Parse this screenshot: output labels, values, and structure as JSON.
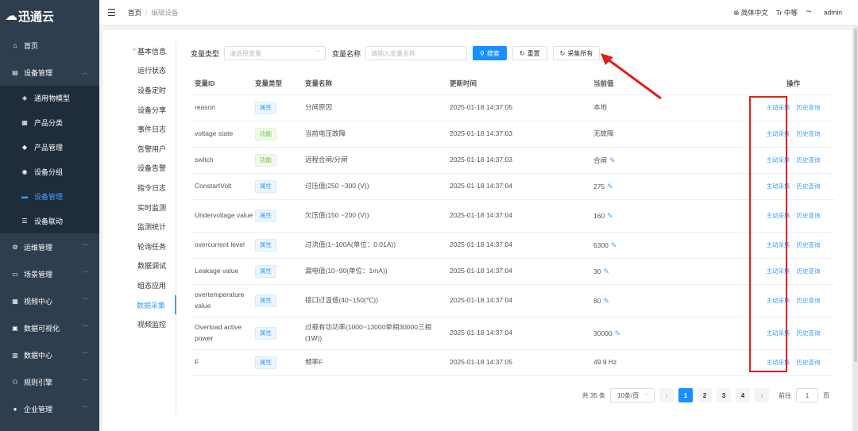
{
  "app": {
    "logo": "迅通云"
  },
  "sidebar": {
    "items": [
      {
        "label": "首页",
        "icon": "home-icon",
        "glyph": "⌂"
      },
      {
        "label": "设备管理",
        "icon": "device-icon",
        "glyph": "▤",
        "open": true
      },
      {
        "label": "运维管理",
        "icon": "ops-icon",
        "glyph": "⚙"
      },
      {
        "label": "场景管理",
        "icon": "scene-icon",
        "glyph": "▭"
      },
      {
        "label": "视频中心",
        "icon": "video-icon",
        "glyph": "▦"
      },
      {
        "label": "数据可视化",
        "icon": "visual-icon",
        "glyph": "▣"
      },
      {
        "label": "数据中心",
        "icon": "data-icon",
        "glyph": "▥"
      },
      {
        "label": "规则引擎",
        "icon": "rule-icon",
        "glyph": "⚇"
      },
      {
        "label": "企业管理",
        "icon": "enterprise-icon",
        "glyph": "●"
      }
    ],
    "sub": [
      {
        "label": "通用物模型",
        "glyph": "◈"
      },
      {
        "label": "产品分类",
        "glyph": "▦"
      },
      {
        "label": "产品管理",
        "glyph": "◆"
      },
      {
        "label": "设备分组",
        "glyph": "◉"
      },
      {
        "label": "设备管理",
        "glyph": "▬",
        "active": true
      },
      {
        "label": "设备联动",
        "glyph": "☰"
      }
    ]
  },
  "header": {
    "breadcrumb_home": "首页",
    "breadcrumb_sep": "/",
    "breadcrumb_current": "编辑设备",
    "lang": "简体中文",
    "size": "中等",
    "user": "admin"
  },
  "tabs": [
    "基本信息",
    "运行状态",
    "设备定时",
    "设备分享",
    "事件日志",
    "告警用户",
    "设备告警",
    "指令日志",
    "实时监测",
    "监测统计",
    "轮询任务",
    "数据调试",
    "组态应用",
    "数据采集",
    "视频监控"
  ],
  "tab_required_mark": "*",
  "active_tab": 13,
  "filter": {
    "type_label": "变量类型",
    "type_placeholder": "请选择变量",
    "name_label": "变量名称",
    "name_placeholder": "请输入变量名称",
    "search": "搜索",
    "reset": "重置",
    "collect_all": "采集所有"
  },
  "table": {
    "headers": [
      "变量ID",
      "变量类型",
      "变量名称",
      "更新时间",
      "当前值",
      "操作"
    ],
    "rows": [
      {
        "id": "reason",
        "type": "属性",
        "kind": "attr",
        "name": "分闸原因",
        "time": "2025-01-18 14:37:05",
        "value": "本地",
        "editable": false,
        "h": 33
      },
      {
        "id": "voltage state",
        "type": "功能",
        "kind": "func",
        "name": "当前电压故障",
        "time": "2025-01-18 14:37:03",
        "value": "无故障",
        "editable": false,
        "h": 33
      },
      {
        "id": "switch",
        "type": "功能",
        "kind": "func",
        "name": "远程合闸/分闸",
        "time": "2025-01-18 14:37:03",
        "value": "合闸",
        "editable": true,
        "h": 33
      },
      {
        "id": "ConstartVolt",
        "type": "属性",
        "kind": "attr",
        "name": "过压值(250 ~300 (V))",
        "time": "2025-01-18 14:37:04",
        "value": "275",
        "editable": true,
        "h": 33
      },
      {
        "id": "Undervoltage value",
        "type": "属性",
        "kind": "attr",
        "name": "欠压值(150 ~200 (V))",
        "time": "2025-01-18 14:37:04",
        "value": "160",
        "editable": true,
        "h": 41
      },
      {
        "id": "overcurrent level",
        "type": "属性",
        "kind": "attr",
        "name": "过流值(1~100A(单位：0.01A))",
        "time": "2025-01-18 14:37:04",
        "value": "6300",
        "editable": true,
        "h": 33
      },
      {
        "id": "Leakage value",
        "type": "属性",
        "kind": "attr",
        "name": "漏电值(10~90(单位：1mA))",
        "time": "2025-01-18 14:37:04",
        "value": "30",
        "editable": true,
        "h": 33
      },
      {
        "id": "overtemperature value",
        "type": "属性",
        "kind": "attr",
        "name": "接口过温值(40~150(℃))",
        "time": "2025-01-18 14:37:04",
        "value": "80",
        "editable": true,
        "h": 41
      },
      {
        "id": "Overload active power",
        "type": "属性",
        "kind": "attr",
        "name": "过载有功功率(1000~13000单相30000三相(1W))",
        "time": "2025-01-18 14:37:04",
        "value": "30000",
        "editable": true,
        "h": 41
      },
      {
        "id": "F",
        "type": "属性",
        "kind": "attr",
        "name": "频率F",
        "time": "2025-01-18 14:37:05",
        "value": "49.9 Hz",
        "editable": false,
        "h": 33
      }
    ],
    "op_collect": "主动采集",
    "op_history": "历史查询"
  },
  "pagination": {
    "total": "共 35 条",
    "page_size": "10条/页",
    "pages": [
      "1",
      "2",
      "3",
      "4"
    ],
    "current": "1",
    "goto_label": "前往",
    "goto_value": "1",
    "goto_suffix": "页"
  },
  "colors": {
    "primary": "#1890ff",
    "annotation": "#e02020",
    "sidebar": "#2f3e4e"
  }
}
